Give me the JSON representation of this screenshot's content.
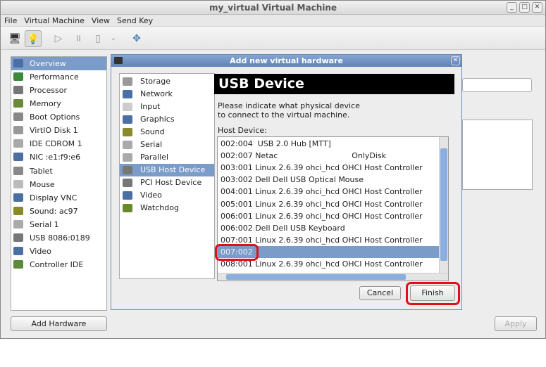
{
  "window": {
    "title": "my_virtual Virtual Machine",
    "controls": [
      "_",
      "□",
      "✕"
    ]
  },
  "menu": [
    "File",
    "Virtual Machine",
    "View",
    "Send Key"
  ],
  "toolbar": {
    "items": [
      "console-icon",
      "details-icon",
      "run-icon",
      "pause-icon",
      "shutdown-icon",
      "dropdown-icon",
      "fullscreen-icon"
    ]
  },
  "sidebar": {
    "items": [
      {
        "label": "Overview",
        "color": "#4a6fa5"
      },
      {
        "label": "Performance",
        "color": "#3a8a3a"
      },
      {
        "label": "Processor",
        "color": "#777"
      },
      {
        "label": "Memory",
        "color": "#6a8a3a"
      },
      {
        "label": "Boot Options",
        "color": "#888"
      },
      {
        "label": "VirtIO Disk 1",
        "color": "#999"
      },
      {
        "label": "IDE CDROM 1",
        "color": "#aaa"
      },
      {
        "label": "NIC :e1:f9:e6",
        "color": "#4a6fa5"
      },
      {
        "label": "Tablet",
        "color": "#888"
      },
      {
        "label": "Mouse",
        "color": "#bbb"
      },
      {
        "label": "Display VNC",
        "color": "#4a6fa5"
      },
      {
        "label": "Sound: ac97",
        "color": "#8a8a2a"
      },
      {
        "label": "Serial 1",
        "color": "#aaa"
      },
      {
        "label": "USB 8086:0189",
        "color": "#777"
      },
      {
        "label": "Video",
        "color": "#4a6fa5"
      },
      {
        "label": "Controller IDE",
        "color": "#5a8a3a"
      }
    ],
    "selected": 0
  },
  "buttons": {
    "add_hardware": "Add Hardware",
    "apply": "Apply"
  },
  "dialog": {
    "title": "Add new virtual hardware",
    "categories": [
      {
        "label": "Storage",
        "color": "#999"
      },
      {
        "label": "Network",
        "color": "#4a6fa5"
      },
      {
        "label": "Input",
        "color": "#ccc"
      },
      {
        "label": "Graphics",
        "color": "#4a6fa5"
      },
      {
        "label": "Sound",
        "color": "#8a8a2a"
      },
      {
        "label": "Serial",
        "color": "#aaa"
      },
      {
        "label": "Parallel",
        "color": "#aaa"
      },
      {
        "label": "USB Host Device",
        "color": "#777"
      },
      {
        "label": "PCI Host Device",
        "color": "#777"
      },
      {
        "label": "Video",
        "color": "#4a6fa5"
      },
      {
        "label": "Watchdog",
        "color": "#6a8a2a"
      }
    ],
    "selected_category": 7,
    "header": "USB Device",
    "description": "Please indicate what physical device\nto connect to the virtual machine.",
    "host_device_label": "Host Device:",
    "devices": [
      "002:004  USB 2.0 Hub [MTT]",
      "002:007 Netac                              OnlyDisk",
      "003:001 Linux 2.6.39 ohci_hcd OHCI Host Controller",
      "003:002 Dell Dell USB Optical Mouse",
      "004:001 Linux 2.6.39 ohci_hcd OHCI Host Controller",
      "005:001 Linux 2.6.39 ohci_hcd OHCI Host Controller",
      "006:001 Linux 2.6.39 ohci_hcd OHCI Host Controller",
      "006:002 Dell Dell USB Keyboard",
      "007:001 Linux 2.6.39 ohci_hcd OHCI Host Controller",
      "007:002",
      "008:001 Linux 2.6.39 ohci_hcd OHCI Host Controller"
    ],
    "selected_device": 9,
    "cancel": "Cancel",
    "finish": "Finish"
  },
  "annotation_color": "#e0101a"
}
